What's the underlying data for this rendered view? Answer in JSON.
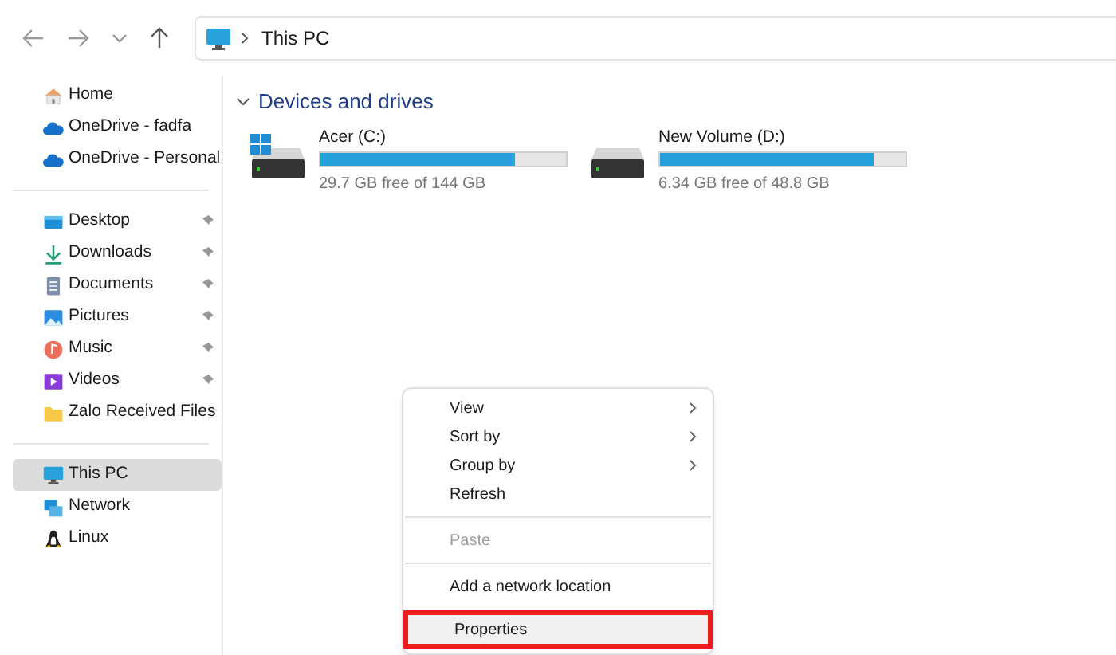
{
  "toolbar": {
    "address": {
      "path": [
        "This PC"
      ]
    }
  },
  "sidebar": {
    "groups": [
      {
        "items": [
          {
            "label": "Home",
            "pinned": false,
            "selected": false
          },
          {
            "label": "OneDrive - fadfa",
            "pinned": false,
            "selected": false
          },
          {
            "label": "OneDrive - Personal",
            "pinned": false,
            "selected": false
          }
        ]
      },
      {
        "items": [
          {
            "label": "Desktop",
            "pinned": true,
            "selected": false
          },
          {
            "label": "Downloads",
            "pinned": true,
            "selected": false
          },
          {
            "label": "Documents",
            "pinned": true,
            "selected": false
          },
          {
            "label": "Pictures",
            "pinned": true,
            "selected": false
          },
          {
            "label": "Music",
            "pinned": true,
            "selected": false
          },
          {
            "label": "Videos",
            "pinned": true,
            "selected": false
          },
          {
            "label": "Zalo Received Files",
            "pinned": false,
            "selected": false
          }
        ]
      },
      {
        "items": [
          {
            "label": "This PC",
            "pinned": false,
            "selected": true
          },
          {
            "label": "Network",
            "pinned": false,
            "selected": false
          },
          {
            "label": "Linux",
            "pinned": false,
            "selected": false
          }
        ]
      }
    ]
  },
  "section": {
    "title": "Devices and drives",
    "expanded": true,
    "drives": [
      {
        "name": "Acer (C:)",
        "level": 0.79,
        "free": "29.7 GB free of 144 GB",
        "system": true
      },
      {
        "name": "New Volume (D:)",
        "level": 0.87,
        "free": "6.34 GB free of 48.8 GB",
        "system": false
      }
    ]
  },
  "context_menu": {
    "items": [
      {
        "kind": "item",
        "label": "View",
        "submenu": true,
        "disabled": false,
        "highlighted": false
      },
      {
        "kind": "item",
        "label": "Sort by",
        "submenu": true,
        "disabled": false,
        "highlighted": false
      },
      {
        "kind": "item",
        "label": "Group by",
        "submenu": true,
        "disabled": false,
        "highlighted": false
      },
      {
        "kind": "item",
        "label": "Refresh",
        "submenu": false,
        "disabled": false,
        "highlighted": false
      },
      {
        "kind": "separator"
      },
      {
        "kind": "item",
        "label": "Paste",
        "submenu": false,
        "disabled": true,
        "highlighted": false
      },
      {
        "kind": "separator"
      },
      {
        "kind": "item",
        "label": "Add a network location",
        "submenu": false,
        "disabled": false,
        "highlighted": false
      },
      {
        "kind": "item",
        "label": "Properties",
        "submenu": false,
        "disabled": false,
        "highlighted": true
      }
    ]
  }
}
